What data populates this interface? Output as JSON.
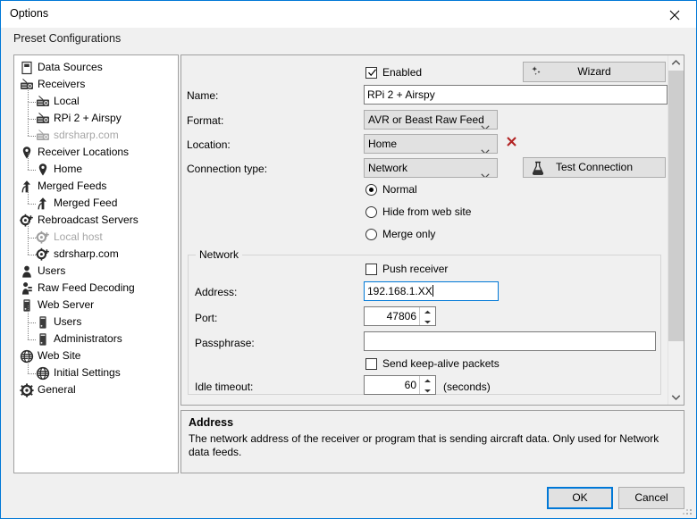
{
  "window": {
    "title": "Options",
    "close_icon": "close-icon"
  },
  "preset": {
    "header": "Preset Configurations"
  },
  "tree": {
    "items": [
      {
        "label": "Data Sources",
        "icon": "document-icon",
        "depth": 0,
        "dim": false
      },
      {
        "label": "Receivers",
        "icon": "receiver-icon",
        "depth": 0,
        "dim": false
      },
      {
        "label": "Local",
        "icon": "receiver-icon",
        "depth": 1,
        "dim": false
      },
      {
        "label": "RPi 2 + Airspy",
        "icon": "receiver-icon",
        "depth": 1,
        "dim": false
      },
      {
        "label": "sdrsharp.com",
        "icon": "receiver-icon",
        "depth": 1,
        "dim": true
      },
      {
        "label": "Receiver Locations",
        "icon": "map-pin-icon",
        "depth": 0,
        "dim": false
      },
      {
        "label": "Home",
        "icon": "map-pin-icon",
        "depth": 1,
        "dim": false
      },
      {
        "label": "Merged Feeds",
        "icon": "merge-arrow-icon",
        "depth": 0,
        "dim": false
      },
      {
        "label": "Merged Feed",
        "icon": "merge-arrow-icon",
        "depth": 1,
        "dim": false
      },
      {
        "label": "Rebroadcast Servers",
        "icon": "gear-plus-icon",
        "depth": 0,
        "dim": false
      },
      {
        "label": "Local host",
        "icon": "gear-plus-icon",
        "depth": 1,
        "dim": true
      },
      {
        "label": "sdrsharp.com",
        "icon": "gear-plus-icon",
        "depth": 1,
        "dim": false
      },
      {
        "label": "Users",
        "icon": "user-icon",
        "depth": 0,
        "dim": false
      },
      {
        "label": "Raw Feed Decoding",
        "icon": "antenna-icon",
        "depth": 0,
        "dim": false
      },
      {
        "label": "Web Server",
        "icon": "server-icon",
        "depth": 0,
        "dim": false
      },
      {
        "label": "Users",
        "icon": "server-icon",
        "depth": 1,
        "dim": false
      },
      {
        "label": "Administrators",
        "icon": "server-icon",
        "depth": 1,
        "dim": false
      },
      {
        "label": "Web Site",
        "icon": "globe-icon",
        "depth": 0,
        "dim": false
      },
      {
        "label": "Initial Settings",
        "icon": "globe-icon",
        "depth": 1,
        "dim": false
      },
      {
        "label": "General",
        "icon": "gear-icon",
        "depth": 0,
        "dim": false
      }
    ]
  },
  "form": {
    "enabled": {
      "label": "Enabled",
      "checked": true
    },
    "wizard_button": {
      "label": "Wizard",
      "icon": "sparkle-icon"
    },
    "name": {
      "label": "Name:",
      "value": "RPi 2 + Airspy"
    },
    "format": {
      "label": "Format:",
      "value": "AVR or Beast Raw Feed"
    },
    "location": {
      "label": "Location:",
      "value": "Home",
      "delete_icon": "red-x-icon"
    },
    "connection_type": {
      "label": "Connection type:",
      "value": "Network"
    },
    "test_connection_button": {
      "label": "Test Connection",
      "icon": "flask-icon"
    },
    "visibility_options": [
      {
        "label": "Normal",
        "selected": true
      },
      {
        "label": "Hide from web site",
        "selected": false
      },
      {
        "label": "Merge only",
        "selected": false
      }
    ],
    "network_group": {
      "title": "Network",
      "push_receiver": {
        "label": "Push receiver",
        "checked": false
      },
      "address": {
        "label": "Address:",
        "value": "192.168.1.XX",
        "focused": true
      },
      "port": {
        "label": "Port:",
        "value": "47806"
      },
      "passphrase": {
        "label": "Passphrase:",
        "value": ""
      },
      "keep_alive": {
        "label": "Send keep-alive packets",
        "checked": false
      },
      "idle_timeout": {
        "label": "Idle timeout:",
        "value": "60",
        "units": "(seconds)"
      }
    }
  },
  "help": {
    "title": "Address",
    "text": "The network address of the receiver or program that is sending aircraft data. Only used for Network data feeds."
  },
  "footer": {
    "ok_label": "OK",
    "cancel_label": "Cancel"
  },
  "colors": {
    "window_border": "#0078d7",
    "accent": "#0078d7",
    "delete_x": "#b22222",
    "panel_bg": "#f0f0f0",
    "field_bg": "#ffffff",
    "disabled_text": "#a6a6a6"
  }
}
